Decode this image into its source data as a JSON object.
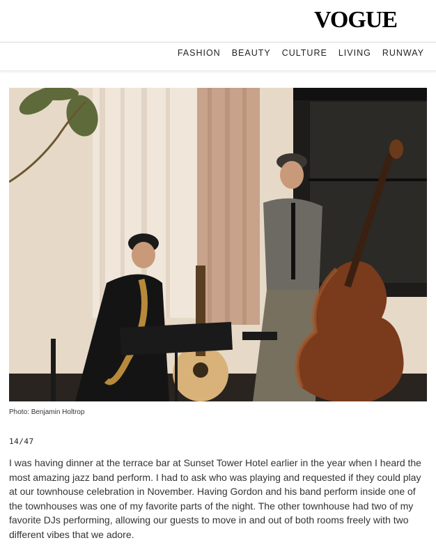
{
  "header": {
    "logo_text": "VOGUE"
  },
  "nav": {
    "items": [
      "FASHION",
      "BEAUTY",
      "CULTURE",
      "LIVING",
      "RUNWAY"
    ]
  },
  "article": {
    "photo_alt": "",
    "photo_credit": "Photo: Benjamin Holtrop",
    "counter": "14/47",
    "body": "I was having dinner at the terrace bar at Sunset Tower Hotel earlier in the year when I heard the most amazing jazz band perform. I had to ask who was playing and requested if they could play at our townhouse celebration in November. Having Gordon and his band perform inside one of the townhouses was one of my favorite parts of the night. The other townhouse had two of my favorite DJs performing, allowing our guests to move in and out of both rooms freely with two different vibes that we adore."
  },
  "colors": {
    "text": "#1a1a1a",
    "divider": "#d9d9d9",
    "photo_wall": "#e8dccb",
    "curtain": "#c9a48d"
  }
}
